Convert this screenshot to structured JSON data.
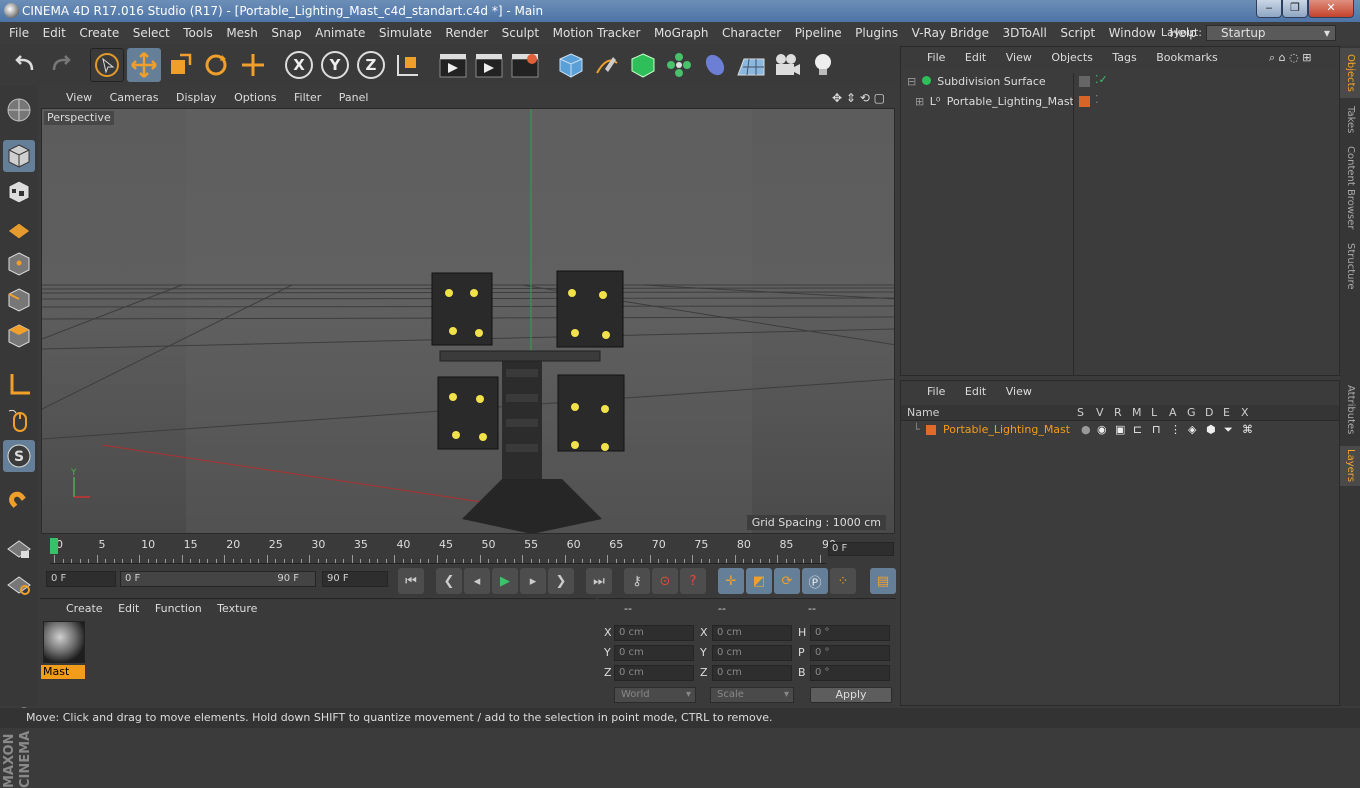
{
  "window": {
    "title": "CINEMA 4D R17.016 Studio (R17) - [Portable_Lighting_Mast_c4d_standart.c4d *] - Main",
    "min": "‒",
    "max": "❐",
    "close": "✕"
  },
  "menubar": {
    "items": [
      "File",
      "Edit",
      "Create",
      "Select",
      "Tools",
      "Mesh",
      "Snap",
      "Animate",
      "Simulate",
      "Render",
      "Sculpt",
      "Motion Tracker",
      "MoGraph",
      "Character",
      "Pipeline",
      "Plugins",
      "V-Ray Bridge",
      "3DToAll",
      "Script",
      "Window",
      "Help"
    ],
    "layout_label": "Layout:",
    "layout_value": "Startup"
  },
  "toolbar": {
    "axis_x": "X",
    "axis_y": "Y",
    "axis_z": "Z"
  },
  "viewport": {
    "menu": [
      "View",
      "Cameras",
      "Display",
      "Options",
      "Filter",
      "Panel"
    ],
    "camera": "Perspective",
    "grid_spacing": "Grid Spacing : 1000 cm"
  },
  "timeline": {
    "ticks": [
      "0",
      "5",
      "10",
      "15",
      "20",
      "25",
      "30",
      "35",
      "40",
      "45",
      "50",
      "55",
      "60",
      "65",
      "70",
      "75",
      "80",
      "85",
      "90"
    ],
    "current_frame": "0 F"
  },
  "transport": {
    "start": "0 F",
    "range_start": "0 F",
    "range_end": "90 F",
    "end": "90 F"
  },
  "material": {
    "menu": [
      "Create",
      "Edit",
      "Function",
      "Texture"
    ],
    "name": "Mast"
  },
  "coordinates": {
    "header": [
      "--",
      "--",
      "--"
    ],
    "rows": [
      {
        "a": "X",
        "av": "0 cm",
        "b": "X",
        "bv": "0 cm",
        "c": "H",
        "cv": "0 °"
      },
      {
        "a": "Y",
        "av": "0 cm",
        "b": "Y",
        "bv": "0 cm",
        "c": "P",
        "cv": "0 °"
      },
      {
        "a": "Z",
        "av": "0 cm",
        "b": "Z",
        "bv": "0 cm",
        "c": "B",
        "cv": "0 °"
      }
    ],
    "space": "World",
    "mode": "Scale",
    "apply": "Apply"
  },
  "objects": {
    "menu": [
      "File",
      "Edit",
      "View",
      "Objects",
      "Tags",
      "Bookmarks"
    ],
    "items": [
      "Subdivision Surface",
      "Portable_Lighting_Mast"
    ]
  },
  "layers": {
    "menu": [
      "File",
      "Edit",
      "View"
    ],
    "columns": [
      "Name",
      "S",
      "V",
      "R",
      "M",
      "L",
      "A",
      "G",
      "D",
      "E",
      "X"
    ],
    "row_name": "Portable_Lighting_Mast",
    "layer_color": "#e06a2a"
  },
  "right_tabs": [
    "Objects",
    "Takes",
    "Content Browser",
    "Structure",
    "Attributes",
    "Layers"
  ],
  "status": "Move: Click and drag to move elements. Hold down SHIFT to quantize movement / add to the selection in point mode, CTRL to remove.",
  "branding": "MAXON CINEMA 4D",
  "colors": {
    "accent": "#f19d19",
    "selected_tool": "#657f99"
  }
}
